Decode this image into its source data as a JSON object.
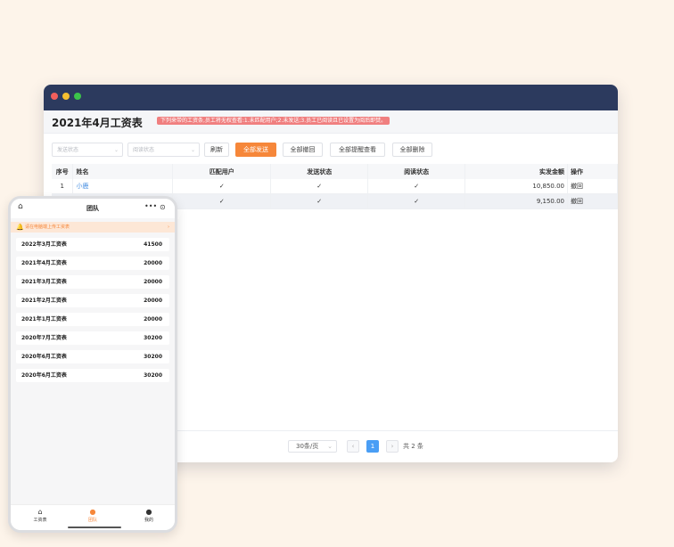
{
  "desktop": {
    "page_title": "2021年4月工资表",
    "notice": "下列来带的工资条,员工将无权查看:1.未匹配用户;2.未发送;3.员工已阅读且已设置为阅后即焚。",
    "filters": {
      "send_status_placeholder": "发送状态",
      "read_status_placeholder": "阅读状态"
    },
    "buttons": {
      "refresh": "刷新",
      "send_all": "全部发送",
      "withdraw_all": "全部撤回",
      "remind_all": "全部提醒查看",
      "delete_all": "全部删除"
    },
    "table": {
      "headers": [
        "序号",
        "姓名",
        "匹配用户",
        "发送状态",
        "阅读状态",
        "实发金额",
        "操作"
      ],
      "rows": [
        {
          "index": "1",
          "name": "小鹿",
          "matched": "✓",
          "sent": "✓",
          "read": "✓",
          "amount": "10,850.00",
          "action": "撤回"
        },
        {
          "index": "",
          "name": "",
          "matched": "✓",
          "sent": "✓",
          "read": "✓",
          "amount": "9,150.00",
          "action": "撤回"
        }
      ]
    },
    "pagination": {
      "page_size": "30条/页",
      "prev": "‹",
      "current": "1",
      "next": "›",
      "total": "共 2 条"
    }
  },
  "mobile": {
    "title": "团队",
    "tip": "请在电脑端上传工资表",
    "items": [
      {
        "name": "2022年3月工资表",
        "value": "41500"
      },
      {
        "name": "2021年4月工资表",
        "value": "20000"
      },
      {
        "name": "2021年3月工资表",
        "value": "20000"
      },
      {
        "name": "2021年2月工资表",
        "value": "20000"
      },
      {
        "name": "2021年1月工资表",
        "value": "20000"
      },
      {
        "name": "2020年7月工资表",
        "value": "30200"
      },
      {
        "name": "2020年6月工资表",
        "value": "30200"
      },
      {
        "name": "2020年6月工资表",
        "value": "30200"
      }
    ],
    "tabs": [
      {
        "label": "工资表",
        "icon": "home-icon"
      },
      {
        "label": "团队",
        "icon": "team-icon"
      },
      {
        "label": "我的",
        "icon": "user-icon"
      }
    ]
  },
  "colors": {
    "accent": "#f6873a",
    "titlebar": "#2c3a5e",
    "link": "#4a90e2",
    "page_bg": "#fdf4ea"
  }
}
